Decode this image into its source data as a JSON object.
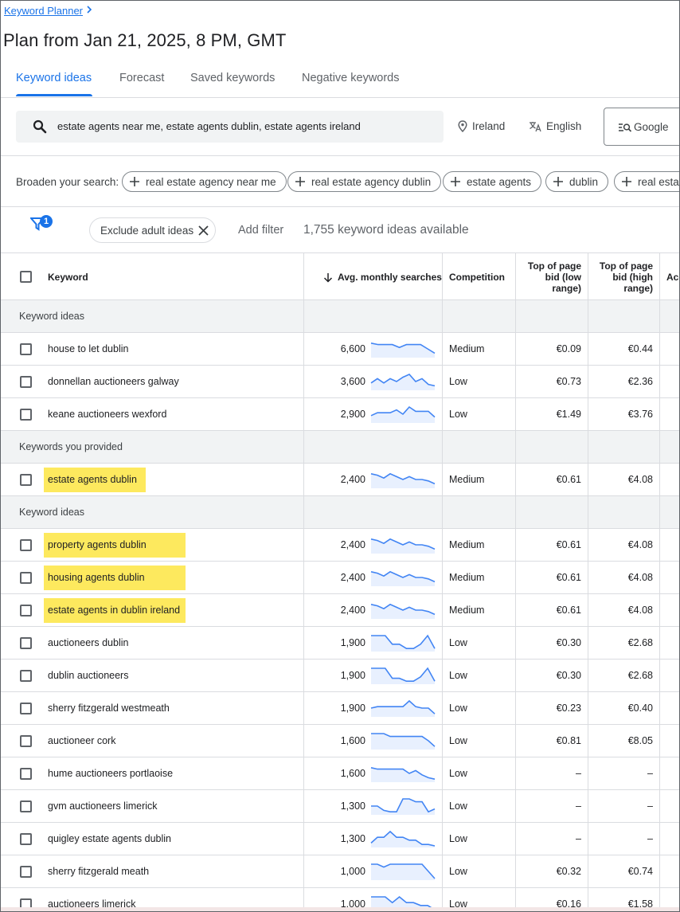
{
  "breadcrumb": {
    "label": "Keyword Planner"
  },
  "page": {
    "title": "Plan from Jan 21, 2025, 8 PM, GMT"
  },
  "tabs": [
    {
      "label": "Keyword ideas",
      "active": true
    },
    {
      "label": "Forecast",
      "active": false
    },
    {
      "label": "Saved keywords",
      "active": false
    },
    {
      "label": "Negative keywords",
      "active": false
    }
  ],
  "search": {
    "value": "estate agents near me, estate agents dublin, estate agents ireland",
    "location": "Ireland",
    "language": "English",
    "network": "Google"
  },
  "broaden": {
    "label": "Broaden your search:",
    "chips": [
      "real estate agency near me",
      "real estate agency dublin",
      "estate agents",
      "dublin",
      "real estate"
    ]
  },
  "filters": {
    "badge_count": "1",
    "exclude_label": "Exclude adult ideas",
    "add_filter": "Add filter",
    "ideas_available": "1,755 keyword ideas available"
  },
  "table": {
    "headers": {
      "keyword": "Keyword",
      "avg_searches": "Avg. monthly searches",
      "competition": "Competition",
      "bid_low": [
        "Top of page",
        "bid (low",
        "range)"
      ],
      "bid_high": [
        "Top of page",
        "bid (high",
        "range)"
      ],
      "account": "Acc"
    },
    "sections": [
      {
        "label": "Keyword ideas",
        "rows": [
          {
            "keyword": "house to let dublin",
            "searches": "6,600",
            "trend": [
              9,
              8,
              8,
              8,
              6,
              8,
              8,
              8,
              5,
              2
            ],
            "competition": "Medium",
            "low": "€0.09",
            "high": "€0.44",
            "highlight": false
          },
          {
            "keyword": "donnellan auctioneers galway",
            "searches": "3,600",
            "trend": [
              4,
              7,
              4,
              7,
              5,
              8,
              10,
              5,
              7,
              3,
              2
            ],
            "competition": "Low",
            "low": "€0.73",
            "high": "€2.36",
            "highlight": false
          },
          {
            "keyword": "keane auctioneers wexford",
            "searches": "2,900",
            "trend": [
              4,
              6,
              6,
              6,
              8,
              5,
              10,
              7,
              7,
              7,
              3
            ],
            "competition": "Low",
            "low": "€1.49",
            "high": "€3.76",
            "highlight": false
          }
        ]
      },
      {
        "label": "Keywords you provided",
        "rows": [
          {
            "keyword": "estate agents dublin",
            "searches": "2,400",
            "trend": [
              9,
              8,
              6,
              9,
              7,
              5,
              7,
              5,
              5,
              4,
              2
            ],
            "competition": "Medium",
            "low": "€0.61",
            "high": "€4.08",
            "highlight": true
          }
        ]
      },
      {
        "label": "Keyword ideas",
        "rows": [
          {
            "keyword": "property agents dublin",
            "searches": "2,400",
            "trend": [
              9,
              8,
              6,
              9,
              7,
              5,
              7,
              5,
              5,
              4,
              2
            ],
            "competition": "Medium",
            "low": "€0.61",
            "high": "€4.08",
            "highlight": true
          },
          {
            "keyword": "housing agents dublin",
            "searches": "2,400",
            "trend": [
              9,
              8,
              6,
              9,
              7,
              5,
              7,
              5,
              5,
              4,
              2
            ],
            "competition": "Medium",
            "low": "€0.61",
            "high": "€4.08",
            "highlight": true
          },
          {
            "keyword": "estate agents in dublin ireland",
            "searches": "2,400",
            "trend": [
              9,
              8,
              6,
              9,
              7,
              5,
              7,
              5,
              5,
              4,
              2
            ],
            "competition": "Medium",
            "low": "€0.61",
            "high": "€4.08",
            "highlight": true
          },
          {
            "keyword": "auctioneers dublin",
            "searches": "1,900",
            "trend": [
              10,
              10,
              10,
              4,
              4,
              1,
              1,
              4,
              10,
              1
            ],
            "competition": "Low",
            "low": "€0.30",
            "high": "€2.68",
            "highlight": false
          },
          {
            "keyword": "dublin auctioneers",
            "searches": "1,900",
            "trend": [
              10,
              10,
              10,
              3,
              3,
              1,
              1,
              4,
              10,
              1
            ],
            "competition": "Low",
            "low": "€0.30",
            "high": "€2.68",
            "highlight": false
          },
          {
            "keyword": "sherry fitzgerald westmeath",
            "searches": "1,900",
            "trend": [
              5,
              6,
              6,
              6,
              6,
              6,
              10,
              6,
              5,
              5,
              1
            ],
            "competition": "Low",
            "low": "€0.23",
            "high": "€0.40",
            "highlight": false
          },
          {
            "keyword": "auctioneer cork",
            "searches": "1,600",
            "trend": [
              10,
              10,
              10,
              8,
              8,
              8,
              8,
              8,
              8,
              5,
              1
            ],
            "competition": "Low",
            "low": "€0.81",
            "high": "€8.05",
            "highlight": false
          },
          {
            "keyword": "hume auctioneers portlaoise",
            "searches": "1,600",
            "trend": [
              9,
              8,
              8,
              8,
              8,
              8,
              5,
              7,
              4,
              2,
              1
            ],
            "competition": "Low",
            "low": "–",
            "high": "–",
            "highlight": false
          },
          {
            "keyword": "gvm auctioneers limerick",
            "searches": "1,300",
            "trend": [
              5,
              5,
              2,
              1,
              1,
              10,
              10,
              8,
              8,
              1,
              3
            ],
            "competition": "Low",
            "low": "–",
            "high": "–",
            "highlight": false
          },
          {
            "keyword": "quigley estate agents dublin",
            "searches": "1,300",
            "trend": [
              2,
              6,
              6,
              10,
              6,
              6,
              4,
              4,
              1,
              1,
              0
            ],
            "competition": "Low",
            "low": "–",
            "high": "–",
            "highlight": false
          },
          {
            "keyword": "sherry fitzgerald meath",
            "searches": "1,000",
            "trend": [
              10,
              10,
              8,
              10,
              10,
              10,
              10,
              10,
              10,
              5,
              0
            ],
            "competition": "Low",
            "low": "€0.32",
            "high": "€0.74",
            "highlight": false
          },
          {
            "keyword": "auctioneers limerick",
            "searches": "1,000",
            "trend": [
              10,
              10,
              10,
              6,
              10,
              6,
              6,
              4,
              4,
              1
            ],
            "competition": "Low",
            "low": "€0.16",
            "high": "€1.58",
            "highlight": false
          }
        ]
      }
    ]
  },
  "colors": {
    "accent": "#1a73e8",
    "spark_line": "#4285f4",
    "spark_fill": "#e8f0fe",
    "highlight": "#fde74c"
  }
}
